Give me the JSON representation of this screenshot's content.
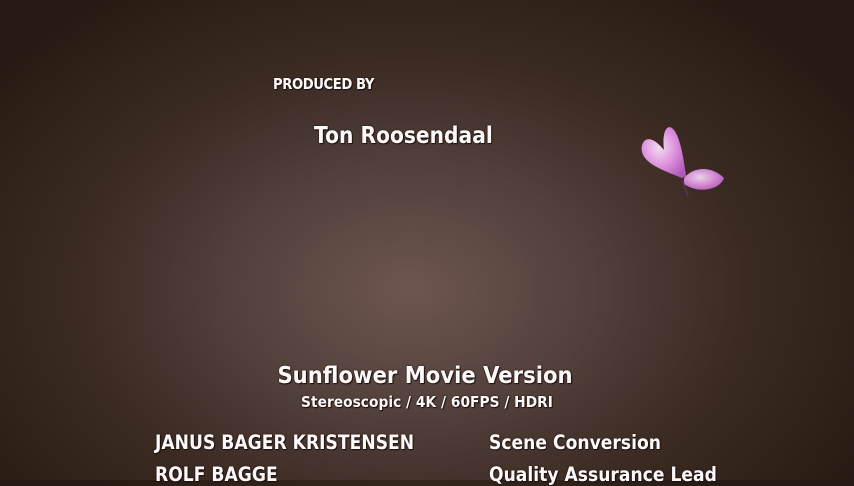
{
  "credits": {
    "produced_by_label": "PRODUCED BY",
    "producer": "Ton Roosendaal",
    "version_title": "Sunflower Movie Version",
    "version_subtitle": "Stereoscopic / 4K / 60FPS / HDRI",
    "rows": [
      {
        "name": "JANUS BAGER KRISTENSEN",
        "role": "Scene Conversion"
      },
      {
        "name": "ROLF BAGGE",
        "role": "Quality Assurance Lead"
      }
    ]
  },
  "colors": {
    "text": "#fdf8fa",
    "butterfly": "#e07ee0"
  }
}
